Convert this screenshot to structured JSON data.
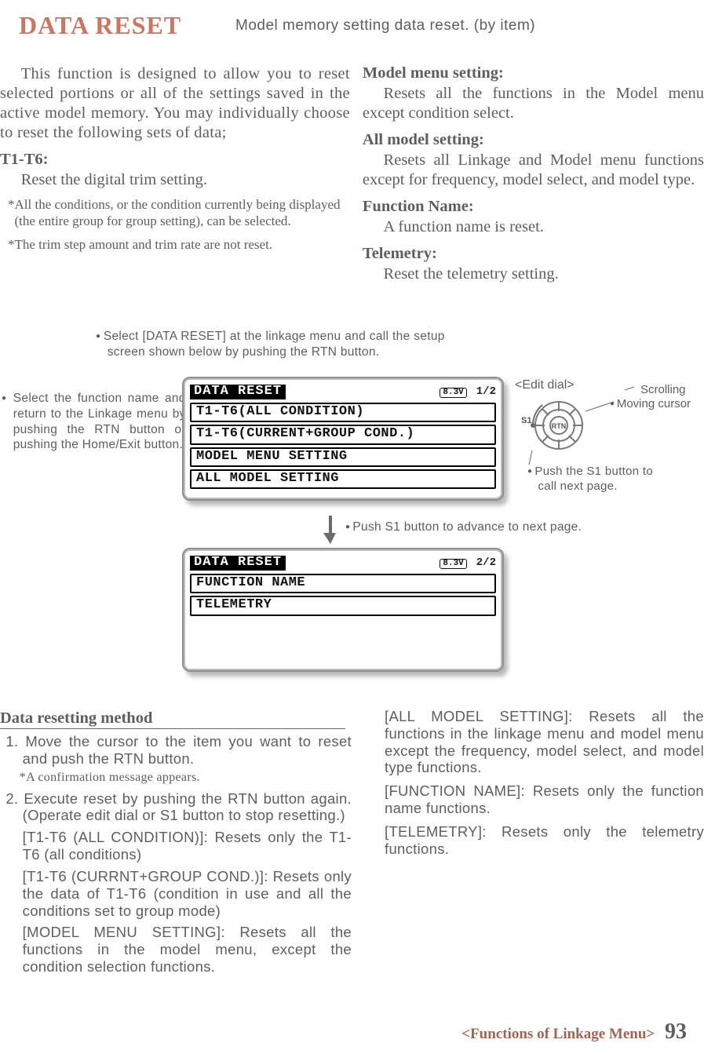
{
  "header": {
    "title": "DATA RESET",
    "subtitle": "Model memory setting data reset. (by item)"
  },
  "intro_left": {
    "p1": "This function is designed to allow you to reset selected portions or all of the settings saved in the active model memory. You may individually choose to reset the following sets of data;",
    "h_t1t6": "T1-T6:",
    "t1t6_body": "Reset the digital trim setting.",
    "note1": "*All the conditions, or the condition currently being displayed (the entire group for group setting), can be selected.",
    "note2": "*The trim step amount and trim rate are not reset."
  },
  "intro_right": {
    "h_model": "Model menu setting:",
    "p_model": "Resets all the functions in the Model menu except condition select.",
    "h_all": "All model setting:",
    "p_all": "Resets all Linkage and Model menu functions except for frequency, model select, and model type.",
    "h_func": "Function Name:",
    "p_func": "A function name is reset.",
    "h_tel": "Telemetry:",
    "p_tel": "Reset the telemetry setting."
  },
  "annotations": {
    "top_center": "Select [DATA RESET] at the linkage menu and call the setup screen shown below by pushing the RTN button.",
    "left_box": "Select the function name and return to the Linkage menu by pushing the RTN button or pushing the Home/Exit button.",
    "between_screens": "Push S1 button to advance to next page."
  },
  "dial": {
    "label": "<Edit dial>",
    "scroll": "Scrolling",
    "move": "Moving cursor",
    "s1": "S1",
    "rtn": "RTN",
    "s1_note": "Push the S1 button to call next page."
  },
  "lcd1": {
    "title": "DATA RESET",
    "batt": "8.3V",
    "page": "1/2",
    "rows": [
      "T1-T6(ALL CONDITION)",
      "T1-T6(CURRENT+GROUP COND.)",
      "MODEL MENU SETTING",
      "ALL MODEL SETTING"
    ]
  },
  "lcd2": {
    "title": "DATA RESET",
    "batt": "8.3V",
    "page": "2/2",
    "rows": [
      "FUNCTION NAME",
      "TELEMETRY"
    ]
  },
  "method": {
    "head": "Data resetting method",
    "step1": "1. Move the cursor to the item you want to reset and push the RTN button.",
    "step1_note": "*A confirmation message appears.",
    "step2": "2. Execute reset by pushing the RTN button again. (Operate edit dial or S1 button to stop resetting.)",
    "sub_a": "[T1-T6 (ALL CONDITION)]: Resets only the T1-T6 (all conditions)",
    "sub_b": "[T1-T6 (CURRNT+GROUP COND.)]: Resets only the data of T1-T6 (condition in use and all the conditions set to group mode)",
    "sub_c": "[MODEL MENU SETTING]: Resets all the functions in the model menu, except the condition selection functions."
  },
  "right_notes": {
    "a": "[ALL MODEL SETTING]: Resets all the functions in the linkage menu and model menu except the frequency, model select, and model type functions.",
    "b": "[FUNCTION NAME]: Resets only the function name functions.",
    "c": "[TELEMETRY]: Resets only the telemetry functions."
  },
  "footer": {
    "section": "<Functions of Linkage Menu>",
    "page": "93"
  }
}
